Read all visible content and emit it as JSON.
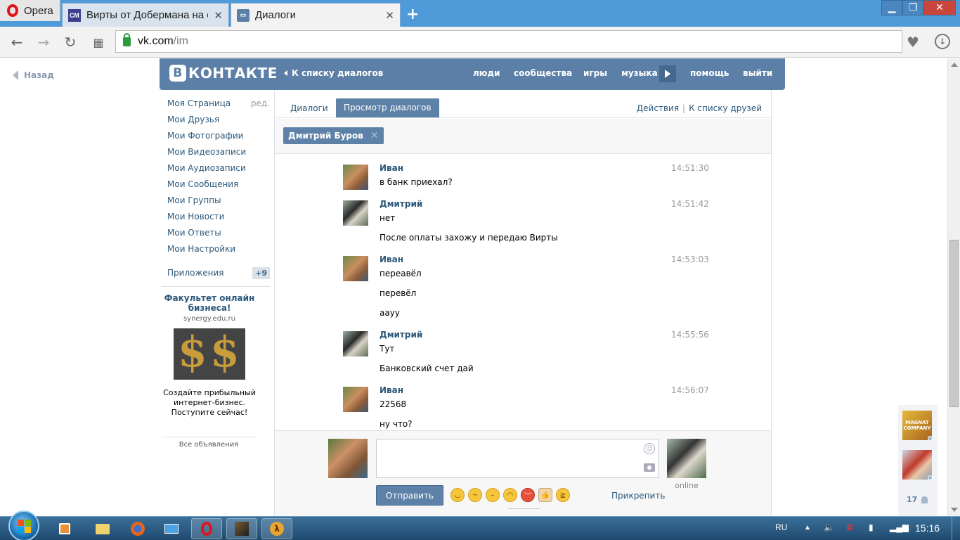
{
  "browser": {
    "opera_label": "Opera",
    "tabs": [
      {
        "title": "Вирты от Добермана на с",
        "favicon": "СМ",
        "favicon_color": "#3e3e8f"
      },
      {
        "title": "Диалоги",
        "favicon": "vk-dialog-icon",
        "favicon_color": "#5b7fa6"
      }
    ],
    "new_tab": "+",
    "url_host": "vk.com",
    "url_path": "/im"
  },
  "page": {
    "back_label": "Назад",
    "logo_b": "B",
    "logo_text": "КОНТАКТЕ",
    "to_dialogs": "К списку диалогов",
    "top_nav": [
      "люди",
      "сообщества",
      "игры",
      "музыка",
      "помощь",
      "выйти"
    ],
    "left_menu": [
      "Моя Страница",
      "Мои Друзья",
      "Мои Фотографии",
      "Мои Видеозаписи",
      "Мои Аудиозаписи",
      "Мои Сообщения",
      "Мои Группы",
      "Мои Новости",
      "Мои Ответы",
      "Мои Настройки"
    ],
    "edit_label": "ред.",
    "apps_label": "Приложения",
    "apps_badge": "+9",
    "ad": {
      "title": "Факультет онлайн бизнеса!",
      "domain": "synergy.edu.ru",
      "text": "Создайте прибыльный интернет-бизнес. Поступите сейчас!",
      "all_ads": "Все объявления"
    },
    "tabs": {
      "dialogs": "Диалоги",
      "view": "Просмотр диалогов",
      "actions": "Действия",
      "friends_list": "К списку друзей"
    },
    "filter_token": "Дмитрий Буров",
    "messages": [
      {
        "author": "Иван",
        "time": "14:51:30",
        "lines": [
          "в банк приехал?"
        ]
      },
      {
        "author": "Дмитрий",
        "time": "14:51:42",
        "lines": [
          "нет",
          "После оплаты захожу и передаю Вирты"
        ]
      },
      {
        "author": "Иван",
        "time": "14:53:03",
        "lines": [
          "переавёл",
          "перевёл",
          "аауу"
        ]
      },
      {
        "author": "Дмитрий",
        "time": "14:55:56",
        "lines": [
          "Тут",
          "Банковский счет дай"
        ]
      },
      {
        "author": "Иван",
        "time": "14:56:07",
        "lines": [
          "22568",
          "ну что?"
        ]
      }
    ],
    "composer": {
      "send_label": "Отправить",
      "attach_label": "Прикрепить",
      "peer_status": "online"
    },
    "side_friends": {
      "count": "17",
      "friend1_caption": "MAGNAT COMPANY"
    }
  },
  "taskbar": {
    "lang": "RU",
    "clock": "15:16"
  },
  "colors": {
    "vk_blue": "#5b7fa6",
    "vk_link": "#2b587a",
    "chrome_blue": "#4f9ad9"
  }
}
